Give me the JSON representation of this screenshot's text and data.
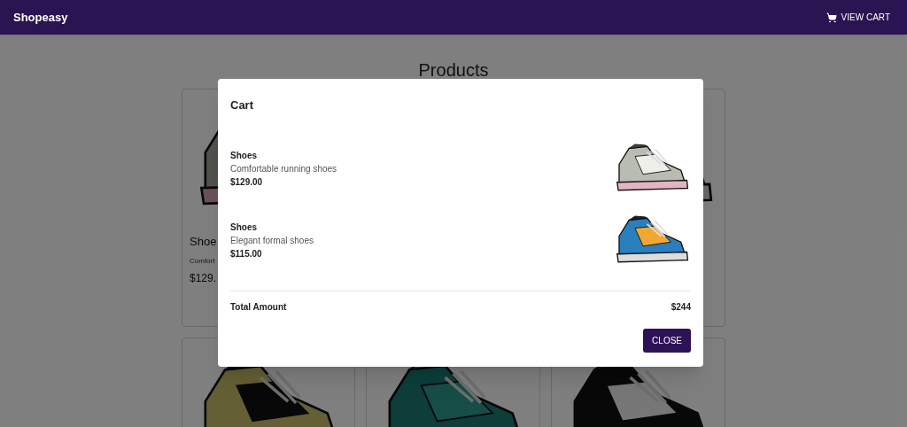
{
  "app_bar": {
    "title": "Shopeasy",
    "cart_button": "VIEW CART"
  },
  "page": {
    "title": "Products",
    "cards": [
      {
        "kind": "drawing",
        "title": "Shoe",
        "description": "Comfort",
        "price": "$129."
      },
      {
        "kind": "covered"
      },
      {
        "kind": "drawing"
      },
      {
        "kind": "drawing"
      },
      {
        "kind": "drawing"
      },
      {
        "kind": "drawing"
      }
    ]
  },
  "cart_dialog": {
    "title": "Cart",
    "items": [
      {
        "name": "Shoes",
        "description": "Comfortable running shoes",
        "price": "$129.00"
      },
      {
        "name": "Shoes",
        "description": "Elegant formal shoes",
        "price": "$115.00"
      }
    ],
    "total_label": "Total Amount",
    "total": "$244",
    "close_button": "CLOSE"
  }
}
